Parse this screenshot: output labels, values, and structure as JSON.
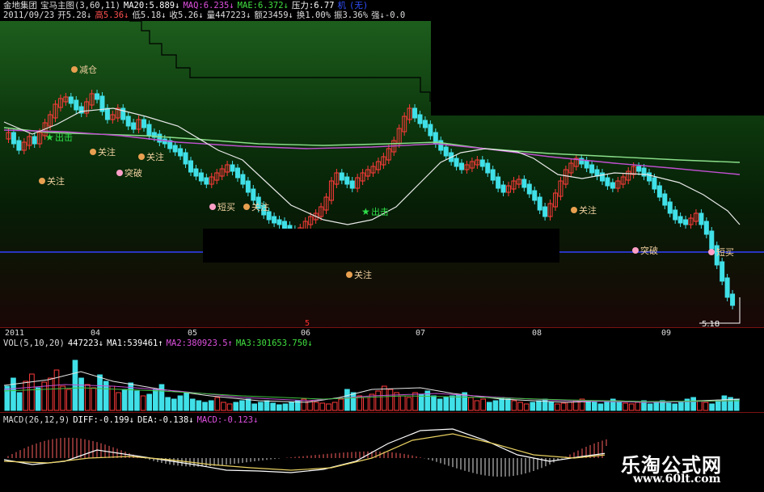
{
  "header": {
    "line1": {
      "name": "金地集团",
      "indicator": "宝马主图(3,60,11)",
      "ma20": "MA20:5.889↓",
      "maq": "MAQ:6.235↓",
      "mae": "MAE:6.372↓",
      "pressure": "压力:6.77",
      "tail_a": "机",
      "tail_b": "(无)"
    },
    "line2": {
      "date": "2011/09/23",
      "open": "开5.28↓",
      "high": "高5.36↓",
      "low": "低5.18↓",
      "close": "收5.26↓",
      "vol": "量447223↓",
      "amount": "额23459↓",
      "turnover": "换1.00%",
      "amplitude": "振3.36%",
      "strength": "强↓-0.0"
    }
  },
  "main_chart": {
    "price_label": "5.18",
    "signals": [
      {
        "text": "减仓",
        "color": "#e8a050"
      },
      {
        "text": "出击",
        "color": "#2ee04a"
      },
      {
        "text": "关注",
        "color": "#e8a050"
      },
      {
        "text": "关注",
        "color": "#e8a050"
      },
      {
        "text": "关注",
        "color": "#e8a050"
      },
      {
        "text": "突破",
        "color": "#ff9fc8"
      },
      {
        "text": "短买",
        "color": "#ff9fc8"
      },
      {
        "text": "关注",
        "color": "#e8a050"
      },
      {
        "text": "出击",
        "color": "#2ee04a"
      },
      {
        "text": "关注",
        "color": "#e8a050"
      },
      {
        "text": "关注",
        "color": "#e8a050"
      },
      {
        "text": "突破",
        "color": "#ff9fc8"
      },
      {
        "text": "短买",
        "color": "#ff9fc8"
      }
    ]
  },
  "axis": {
    "labels": [
      "2011",
      "04",
      "05",
      "06",
      "07",
      "08",
      "09"
    ],
    "marker": "5"
  },
  "vol_header": {
    "name": "VOL(5,10,20)",
    "value": "447223↓",
    "ma1": "MA1:539461↑",
    "ma2": "MA2:380923.5↑",
    "ma3": "MA3:301653.750↓"
  },
  "macd_header": {
    "name": "MACD(26,12,9)",
    "diff": "DIFF:-0.199↓",
    "dea": "DEA:-0.138↓",
    "macd": "MACD:-0.123↓"
  },
  "watermark": {
    "site_name": "乐淘公式网",
    "url": "www.60lt.com"
  },
  "colors": {
    "up": "#ff3a3a",
    "down": "#40e0e8",
    "ma_slow": "#8be08b",
    "ma_purple": "#c050d0",
    "ma_white": "#e8e8e8",
    "pressure": "#000000",
    "support": "#3040ff"
  }
}
